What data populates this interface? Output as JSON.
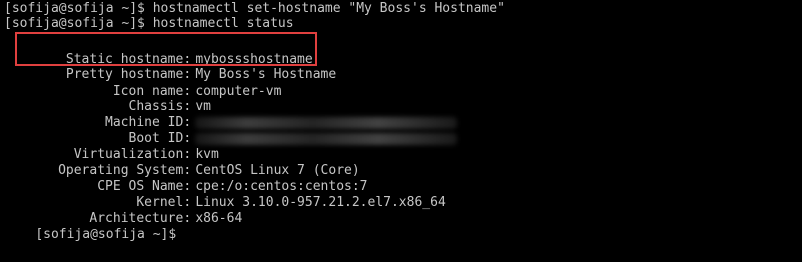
{
  "terminal": {
    "lines": {
      "cmd1": "[sofija@sofija ~]$ hostnamectl set-hostname \"My Boss's Hostname\"",
      "cmd2": "[sofija@sofija ~]$ hostnamectl status",
      "prompt_end": "[sofija@sofija ~]$"
    },
    "status": {
      "static_hostname": {
        "label": "Static hostname",
        "value": "mybossshostname"
      },
      "pretty_hostname": {
        "label": "Pretty hostname",
        "value": "My Boss's Hostname"
      },
      "icon_name": {
        "label": "Icon name",
        "value": "computer-vm"
      },
      "chassis": {
        "label": "Chassis",
        "value": "vm"
      },
      "machine_id": {
        "label": "Machine ID",
        "value": ""
      },
      "boot_id": {
        "label": "Boot ID",
        "value": ""
      },
      "virtualization": {
        "label": "Virtualization",
        "value": "kvm"
      },
      "operating_system": {
        "label": "Operating System",
        "value": "CentOS Linux 7 (Core)"
      },
      "cpe_os_name": {
        "label": "CPE OS Name",
        "value": "cpe:/o:centos:centos:7"
      },
      "kernel": {
        "label": "Kernel",
        "value": "Linux 3.10.0-957.21.2.el7.x86_64"
      },
      "architecture": {
        "label": "Architecture",
        "value": "x86-64"
      }
    },
    "colors": {
      "background": "#000000",
      "text": "#c6c6c6",
      "highlight_border": "#e0403f"
    }
  }
}
